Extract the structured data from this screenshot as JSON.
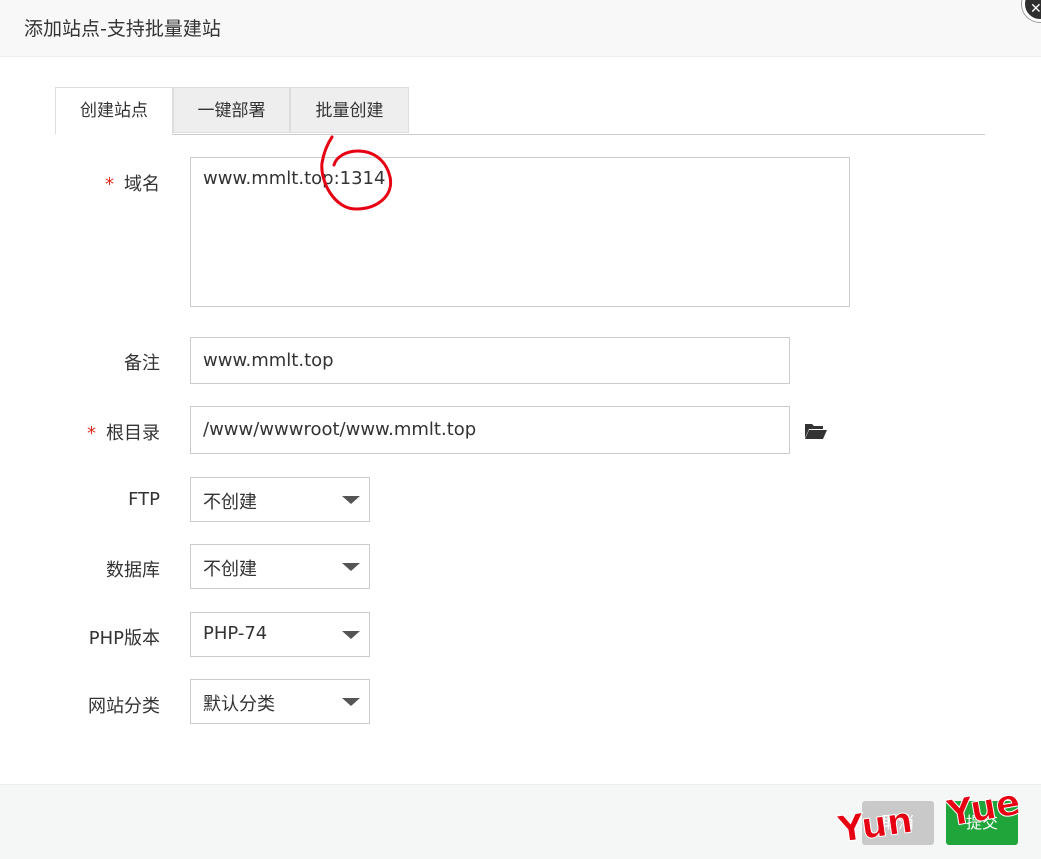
{
  "dialog": {
    "title": "添加站点-支持批量建站"
  },
  "tabs": [
    {
      "label": "创建站点",
      "active": true
    },
    {
      "label": "一键部署",
      "active": false
    },
    {
      "label": "批量创建",
      "active": false
    }
  ],
  "form": {
    "required_mark": "*",
    "domain": {
      "label": "域名",
      "value": "www.mmlt.top:1314"
    },
    "remark": {
      "label": "备注",
      "value": "www.mmlt.top"
    },
    "root": {
      "label": "根目录",
      "value": "/www/wwwroot/www.mmlt.top",
      "icon": "folder-open-icon"
    },
    "ftp": {
      "label": "FTP",
      "selected": "不创建"
    },
    "database": {
      "label": "数据库",
      "selected": "不创建"
    },
    "php": {
      "label": "PHP版本",
      "selected": "PHP-74"
    },
    "category": {
      "label": "网站分类",
      "selected": "默认分类"
    }
  },
  "footer": {
    "cancel_label": "取消",
    "submit_label": "提交"
  },
  "watermark": {
    "part1": "Yun",
    "part2": "Yue"
  },
  "colors": {
    "primary": "#20a53a",
    "required": "#e2291d",
    "annotation": "#e60012"
  }
}
